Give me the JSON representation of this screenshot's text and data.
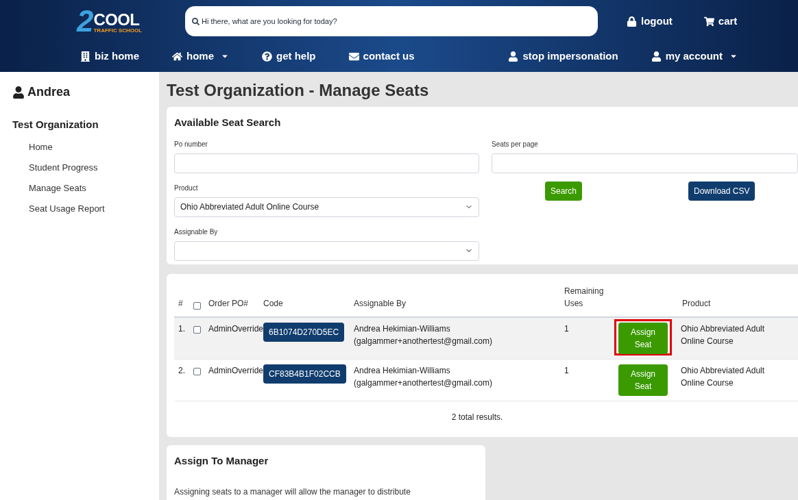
{
  "header": {
    "logo": {
      "number": "2",
      "word": "COOL",
      "tagline": "TRAFFIC SCHOOL"
    },
    "search": {
      "placeholder": "Hi there, what are you looking for today?"
    },
    "top_links": [
      {
        "kind": "lock",
        "label": "logout"
      },
      {
        "kind": "cart",
        "label": "cart"
      }
    ],
    "nav_left": [
      {
        "kind": "building",
        "label": "biz home",
        "dropdown": false
      },
      {
        "kind": "house",
        "label": "home",
        "dropdown": true
      },
      {
        "kind": "help",
        "label": "get help",
        "dropdown": false
      },
      {
        "kind": "mail",
        "label": "contact us",
        "dropdown": false
      }
    ],
    "nav_right": [
      {
        "kind": "user",
        "label": "stop impersonation",
        "dropdown": false
      },
      {
        "kind": "user",
        "label": "my account",
        "dropdown": true
      }
    ]
  },
  "sidebar": {
    "user": "Andrea",
    "organization": "Test Organization",
    "items": [
      {
        "label": "Home"
      },
      {
        "label": "Student Progress"
      },
      {
        "label": "Manage Seats"
      },
      {
        "label": "Seat Usage Report"
      }
    ]
  },
  "page_title": "Test Organization - Manage Seats",
  "search_panel": {
    "title": "Available Seat Search",
    "po_label": "Po number",
    "seats_label": "Seats per page",
    "product_label": "Product",
    "product_value": "Ohio Abbreviated Adult Online Course",
    "assignable_label": "Assignable By",
    "search_button": "Search",
    "download_button": "Download CSV"
  },
  "table": {
    "columns": [
      "#",
      "Order PO#",
      "Code",
      "Assignable By",
      "Remaining Uses",
      "Product"
    ],
    "header_checked": false,
    "rows": [
      {
        "index": "1.",
        "checked": false,
        "po": "AdminOverride",
        "code": "6B1074D270D5EC",
        "name": "Andrea Hekimian-Williams",
        "email": "(galgammer+anothertest@gmail.com)",
        "uses": "1",
        "action": "Assign Seat",
        "product": "Ohio Abbreviated Adult Online Course",
        "highlighted": true
      },
      {
        "index": "2.",
        "checked": false,
        "po": "AdminOverride",
        "code": "CF83B4B1F02CCB",
        "name": "Andrea Hekimian-Williams",
        "email": "(galgammer+anothertest@gmail.com)",
        "uses": "1",
        "action": "Assign Seat",
        "product": "Ohio Abbreviated Adult Online Course",
        "highlighted": false
      }
    ],
    "total": "2 total results."
  },
  "manager_panel": {
    "title": "Assign To Manager",
    "text": "Assigning seats to a manager will allow the manager to distribute"
  }
}
